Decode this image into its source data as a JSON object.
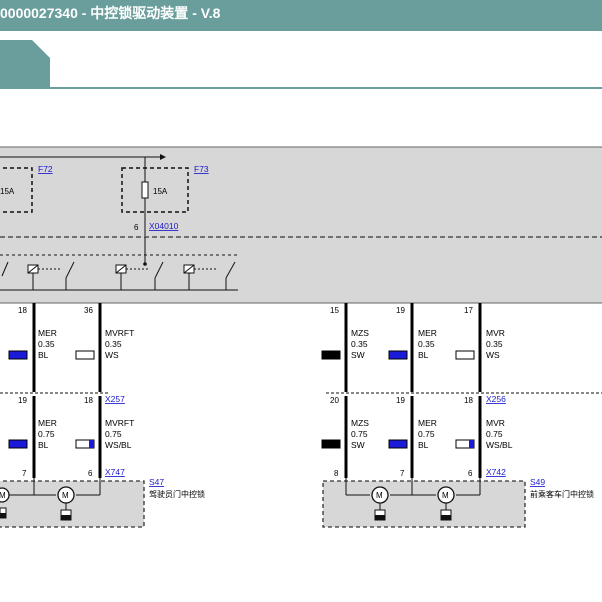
{
  "window": {
    "title": "0000027340 - 中控锁驱动装置 - V.8"
  },
  "colors": {
    "header": "#6a9e9c",
    "panel": "#d7d7d7",
    "blue": "#1a1ad8",
    "link": "#1a1acc"
  },
  "fuses": [
    {
      "id": "F72",
      "rating": "15A"
    },
    {
      "id": "F73",
      "rating": "15A",
      "pin": "6",
      "connector": "X04010"
    }
  ],
  "upper_pins": {
    "a": "18",
    "b": "36",
    "c": "15",
    "d": "19",
    "e": "17"
  },
  "lower_pins": {
    "a": "19",
    "b": "18",
    "c": "20",
    "d": "19",
    "e": "18"
  },
  "bottom_pins": {
    "a": "7",
    "b": "6",
    "c": "8",
    "d": "7",
    "e": "6"
  },
  "connectors": {
    "left_upper": "X257",
    "left_lower": "X747",
    "right_upper": "X256",
    "right_lower": "X742"
  },
  "wires": {
    "upper": [
      {
        "name": "MER",
        "gauge": "0.35",
        "color": "BL"
      },
      {
        "name": "MVRFT",
        "gauge": "0.35",
        "color": "WS"
      },
      {
        "name": "MZS",
        "gauge": "0.35",
        "color": "SW"
      },
      {
        "name": "MER",
        "gauge": "0.35",
        "color": "BL"
      },
      {
        "name": "MVR",
        "gauge": "0.35",
        "color": "WS"
      }
    ],
    "lower": [
      {
        "name": "MER",
        "gauge": "0.75",
        "color": "BL"
      },
      {
        "name": "MVRFT",
        "gauge": "0.75",
        "color": "WS/BL"
      },
      {
        "name": "MZS",
        "gauge": "0.75",
        "color": "SW"
      },
      {
        "name": "MER",
        "gauge": "0.75",
        "color": "BL"
      },
      {
        "name": "MVR",
        "gauge": "0.75",
        "color": "WS/BL"
      }
    ]
  },
  "components": [
    {
      "id": "S47",
      "name": "驾驶员门中控锁"
    },
    {
      "id": "S49",
      "name": "前乘客车门中控锁"
    }
  ]
}
